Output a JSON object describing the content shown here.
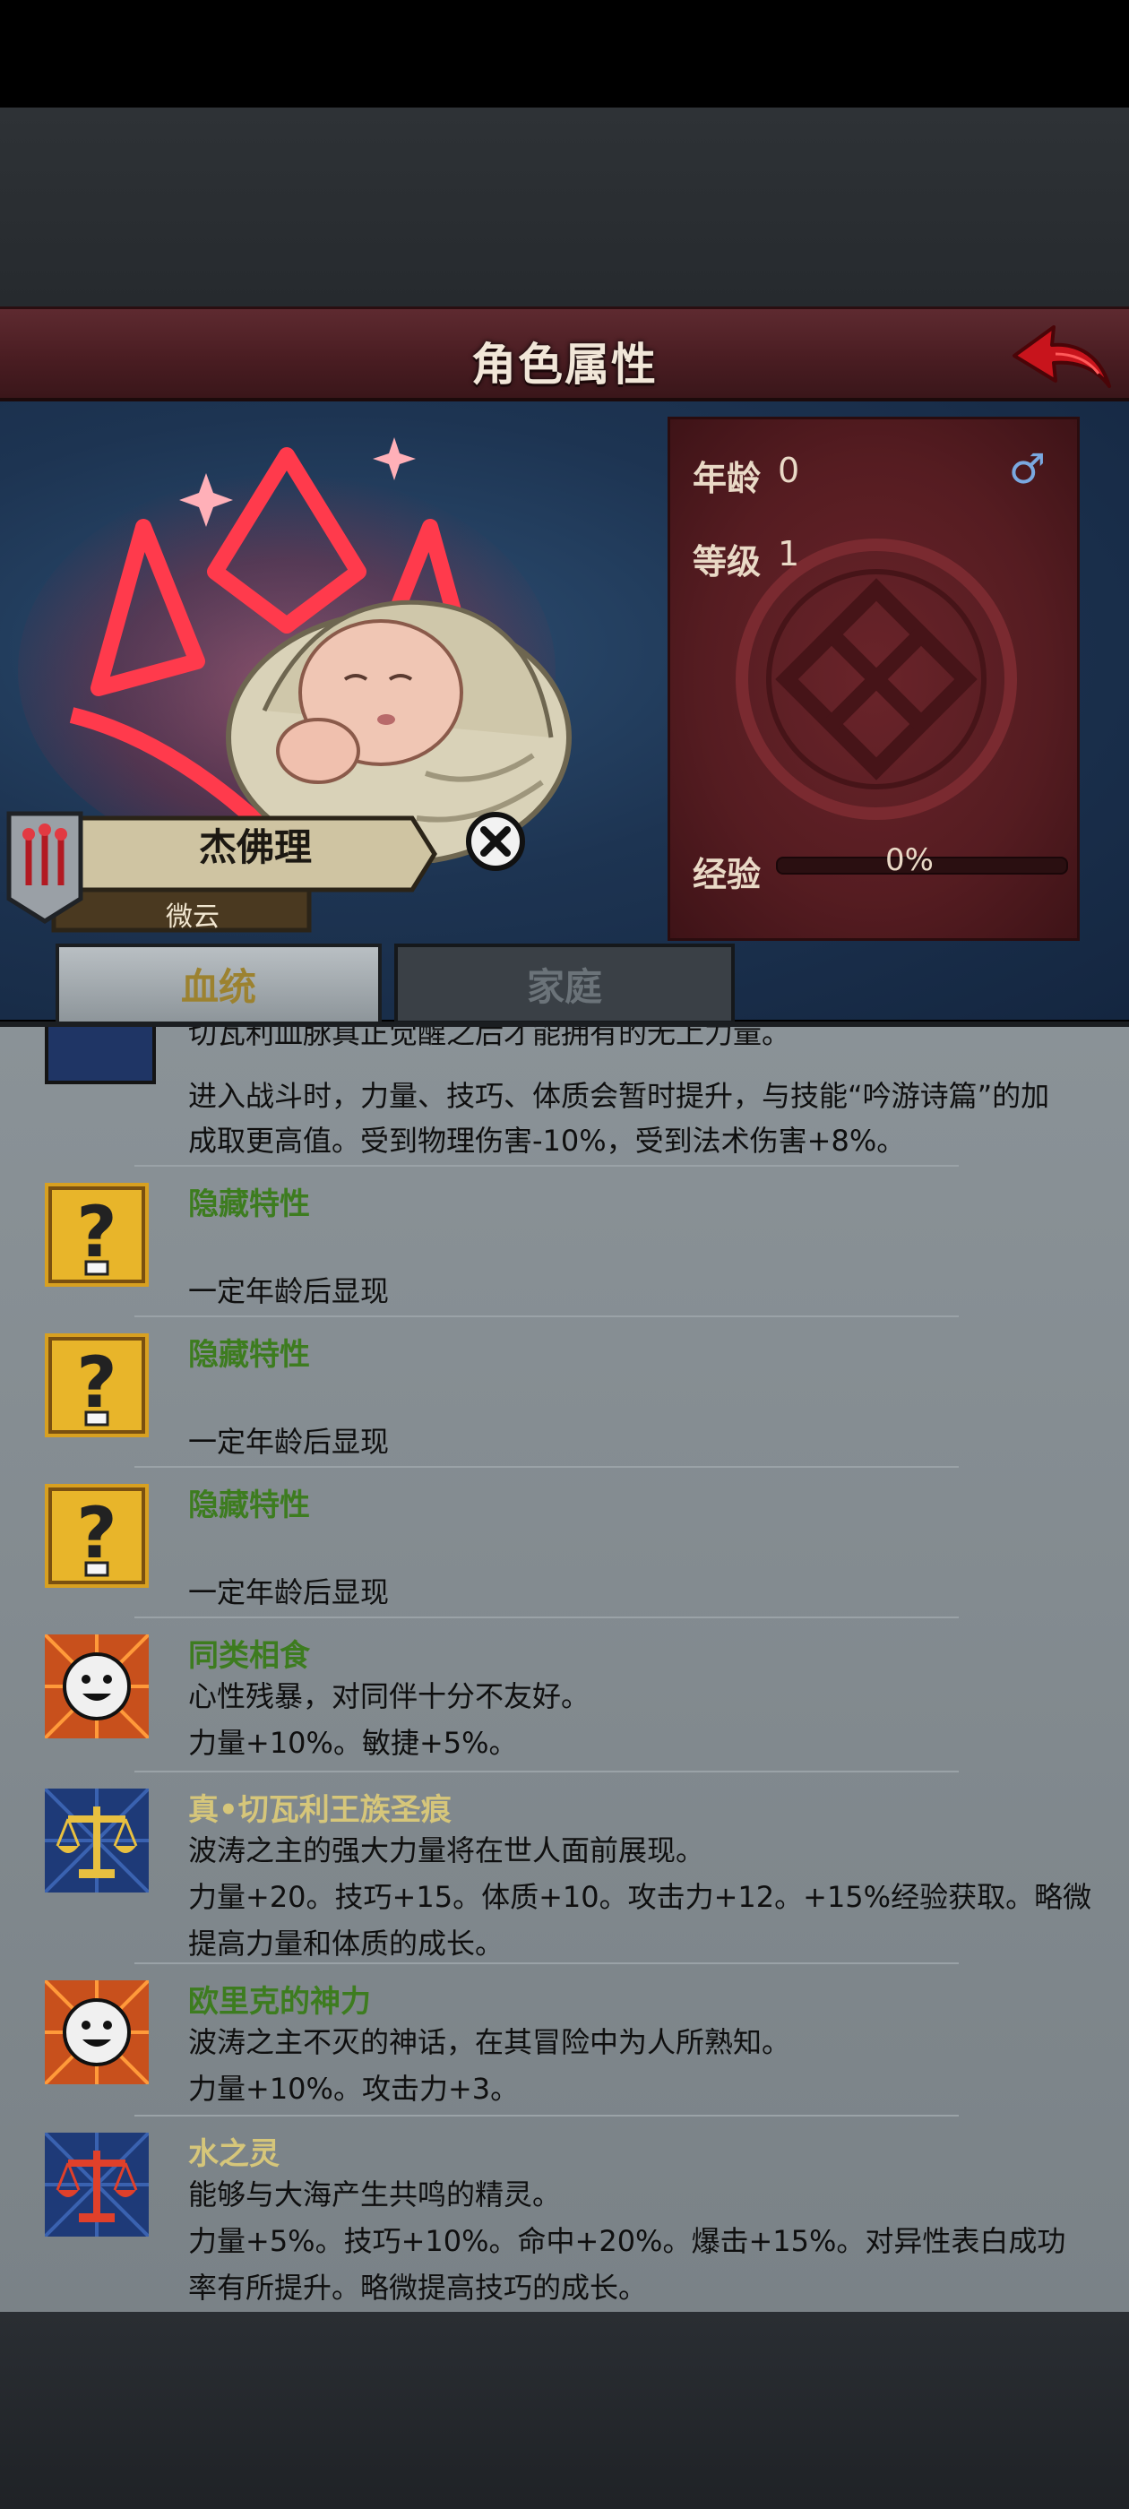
{
  "header": {
    "title": "角色属性",
    "back_icon": "back-arrow-icon"
  },
  "character": {
    "name": "杰佛理",
    "subtitle": "微云",
    "age_label": "年龄",
    "age_value": "0",
    "gender_icon": "male-icon",
    "level_label": "等级",
    "level_value": "1",
    "exp_label": "经验",
    "exp_value": "0%",
    "exp_progress": 0
  },
  "tabs": [
    {
      "label": "血统",
      "active": true
    },
    {
      "label": "家庭",
      "active": false
    }
  ],
  "partial_item": {
    "line_cut": "切瓦利血脉真正觉醒之后才能拥有的无上力量。",
    "line1": "进入战斗时，力量、技巧、体质会暂时提升，与技能“吟游诗篇”的加",
    "line2": "成取更高值。受到物理伤害-10%，受到法术伤害+8%。"
  },
  "traits": [
    {
      "icon": "question-mark-icon",
      "name": "隐藏特性",
      "name_color": "green",
      "lines": [
        "",
        "一定年龄后显现"
      ]
    },
    {
      "icon": "question-mark-icon",
      "name": "隐藏特性",
      "name_color": "green",
      "lines": [
        "",
        "一定年龄后显现"
      ]
    },
    {
      "icon": "question-mark-icon",
      "name": "隐藏特性",
      "name_color": "green",
      "lines": [
        "",
        "一定年龄后显现"
      ]
    },
    {
      "icon": "smiley-face-icon",
      "name": "同类相食",
      "name_color": "green",
      "lines": [
        "心性残暴，对同伴十分不友好。",
        "力量+10%。敏捷+5%。"
      ]
    },
    {
      "icon": "gold-scales-icon",
      "name": "真•切瓦利王族圣痕",
      "name_color": "gold",
      "lines": [
        "波涛之主的强大力量将在世人面前展现。",
        "力量+20。技巧+15。体质+10。攻击力+12。+15%经验获取。略微",
        "提高力量和体质的成长。"
      ]
    },
    {
      "icon": "smiley-face-icon",
      "name": "欧里克的神力",
      "name_color": "green",
      "lines": [
        "波涛之主不灭的神话，在其冒险中为人所熟知。",
        "力量+10%。攻击力+3。"
      ]
    },
    {
      "icon": "red-scales-icon",
      "name": "水之灵",
      "name_color": "gold",
      "lines": [
        "能够与大海产生共鸣的精灵。",
        "力量+5%。技巧+10%。命中+20%。爆击+15%。对异性表白成功",
        "率有所提升。略微提高技巧的成长。"
      ]
    }
  ]
}
